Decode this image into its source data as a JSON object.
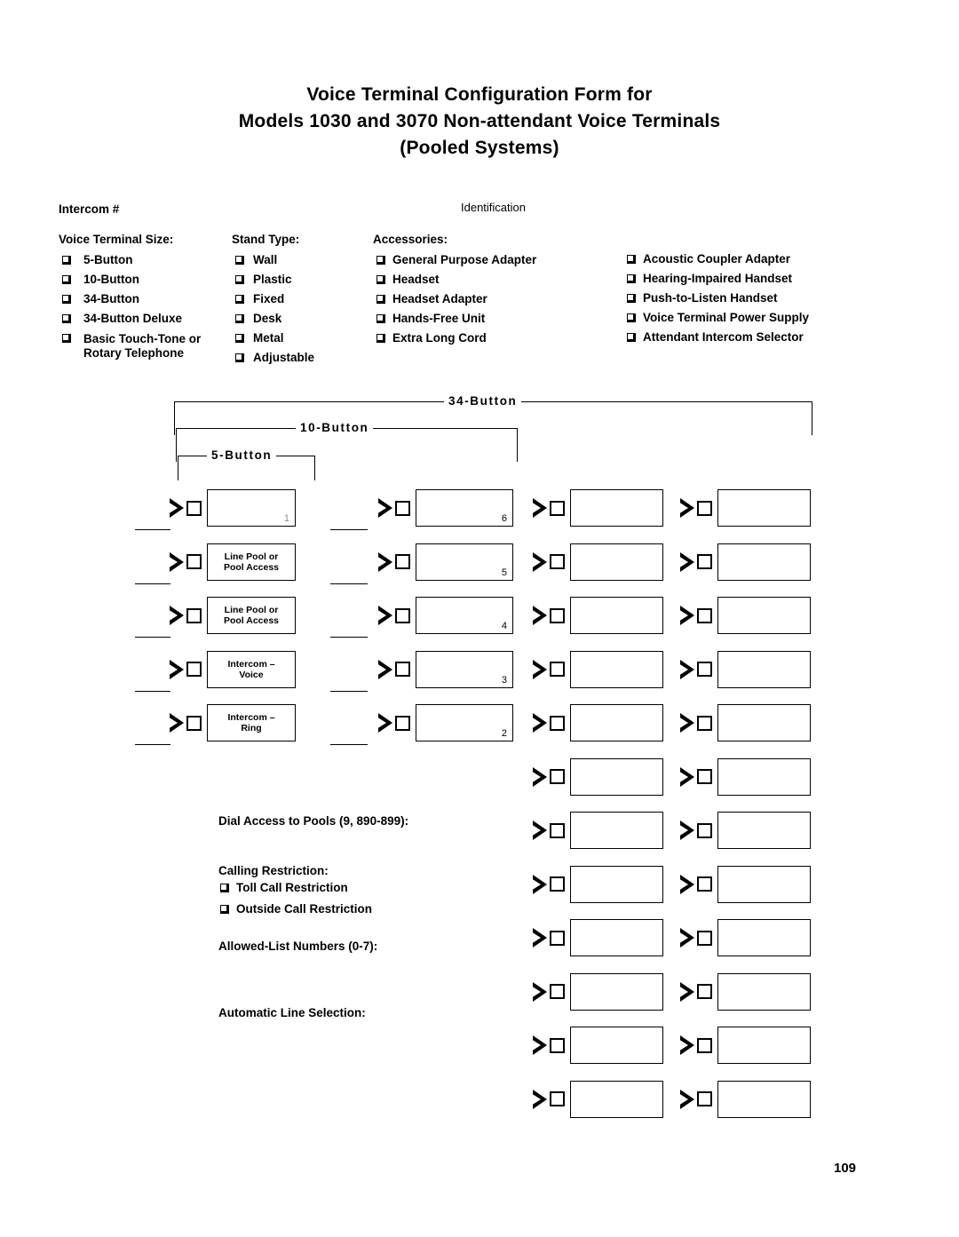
{
  "document": {
    "title_lines": [
      "Voice Terminal Configuration Form for",
      "Models 1030 and 3070 Non-attendant Voice Terminals",
      "(Pooled Systems)"
    ],
    "page_number": "109"
  },
  "form": {
    "intercom_label": "Intercom  #",
    "identification_label": "Identification",
    "voice_terminal_size": {
      "heading": "Voice Terminal Size:",
      "options": [
        "5-Button",
        "10-Button",
        "34-Button",
        "34-Button  Deluxe",
        "Basic Touch-Tone or Rotary Telephone"
      ]
    },
    "stand_type": {
      "heading": "Stand Type:",
      "options": [
        "Wall",
        "Plastic",
        "Fixed",
        "Desk",
        "Metal",
        "Adjustable"
      ]
    },
    "accessories": {
      "heading": "Accessories:",
      "column_left": [
        "General  Purpose  Adapter",
        "Headset",
        "Headset  Adapter",
        "Hands-Free  Unit",
        "Extra Long Cord"
      ],
      "column_right": [
        "Acoustic Coupler Adapter",
        "Hearing-Impaired  Handset",
        "Push-to-Listen Handset",
        "Voice Terminal Power Supply",
        "Attendant Intercom Selector"
      ]
    },
    "dial_access_label": "Dial Access to Pools (9, 890-899):",
    "calling_restriction": {
      "heading": "Calling Restriction:",
      "options": [
        "Toll Call Restriction",
        "Outside  Call  Restriction"
      ]
    },
    "allowed_list_label": "Allowed-List Numbers (0-7):",
    "automatic_line_selection_label": "Automatic Line Selection:"
  },
  "brackets": [
    {
      "label": "34-Button"
    },
    {
      "label": "10-Button"
    },
    {
      "label": "5-Button"
    }
  ],
  "button_grid": {
    "column1": [
      {
        "text": "",
        "number": "1"
      },
      {
        "text": "Line Pool or\nPool Access",
        "number": ""
      },
      {
        "text": "Line Pool or\nPool Access",
        "number": ""
      },
      {
        "text": "Intercom –\nVoice",
        "number": ""
      },
      {
        "text": "Intercom –\nRing",
        "number": ""
      }
    ],
    "column2": [
      {
        "text": "",
        "number": "6"
      },
      {
        "text": "",
        "number": "5"
      },
      {
        "text": "",
        "number": "4"
      },
      {
        "text": "",
        "number": "3"
      },
      {
        "text": "",
        "number": "2"
      }
    ],
    "column3": [
      {
        "text": "",
        "number": ""
      },
      {
        "text": "",
        "number": ""
      },
      {
        "text": "",
        "number": ""
      },
      {
        "text": "",
        "number": ""
      },
      {
        "text": "",
        "number": ""
      },
      {
        "text": "",
        "number": ""
      },
      {
        "text": "",
        "number": ""
      },
      {
        "text": "",
        "number": ""
      },
      {
        "text": "",
        "number": ""
      },
      {
        "text": "",
        "number": ""
      },
      {
        "text": "",
        "number": ""
      },
      {
        "text": "",
        "number": ""
      }
    ],
    "column4": [
      {
        "text": "",
        "number": ""
      },
      {
        "text": "",
        "number": ""
      },
      {
        "text": "",
        "number": ""
      },
      {
        "text": "",
        "number": ""
      },
      {
        "text": "",
        "number": ""
      },
      {
        "text": "",
        "number": ""
      },
      {
        "text": "",
        "number": ""
      },
      {
        "text": "",
        "number": ""
      },
      {
        "text": "",
        "number": ""
      },
      {
        "text": "",
        "number": ""
      },
      {
        "text": "",
        "number": ""
      },
      {
        "text": "",
        "number": ""
      }
    ]
  }
}
